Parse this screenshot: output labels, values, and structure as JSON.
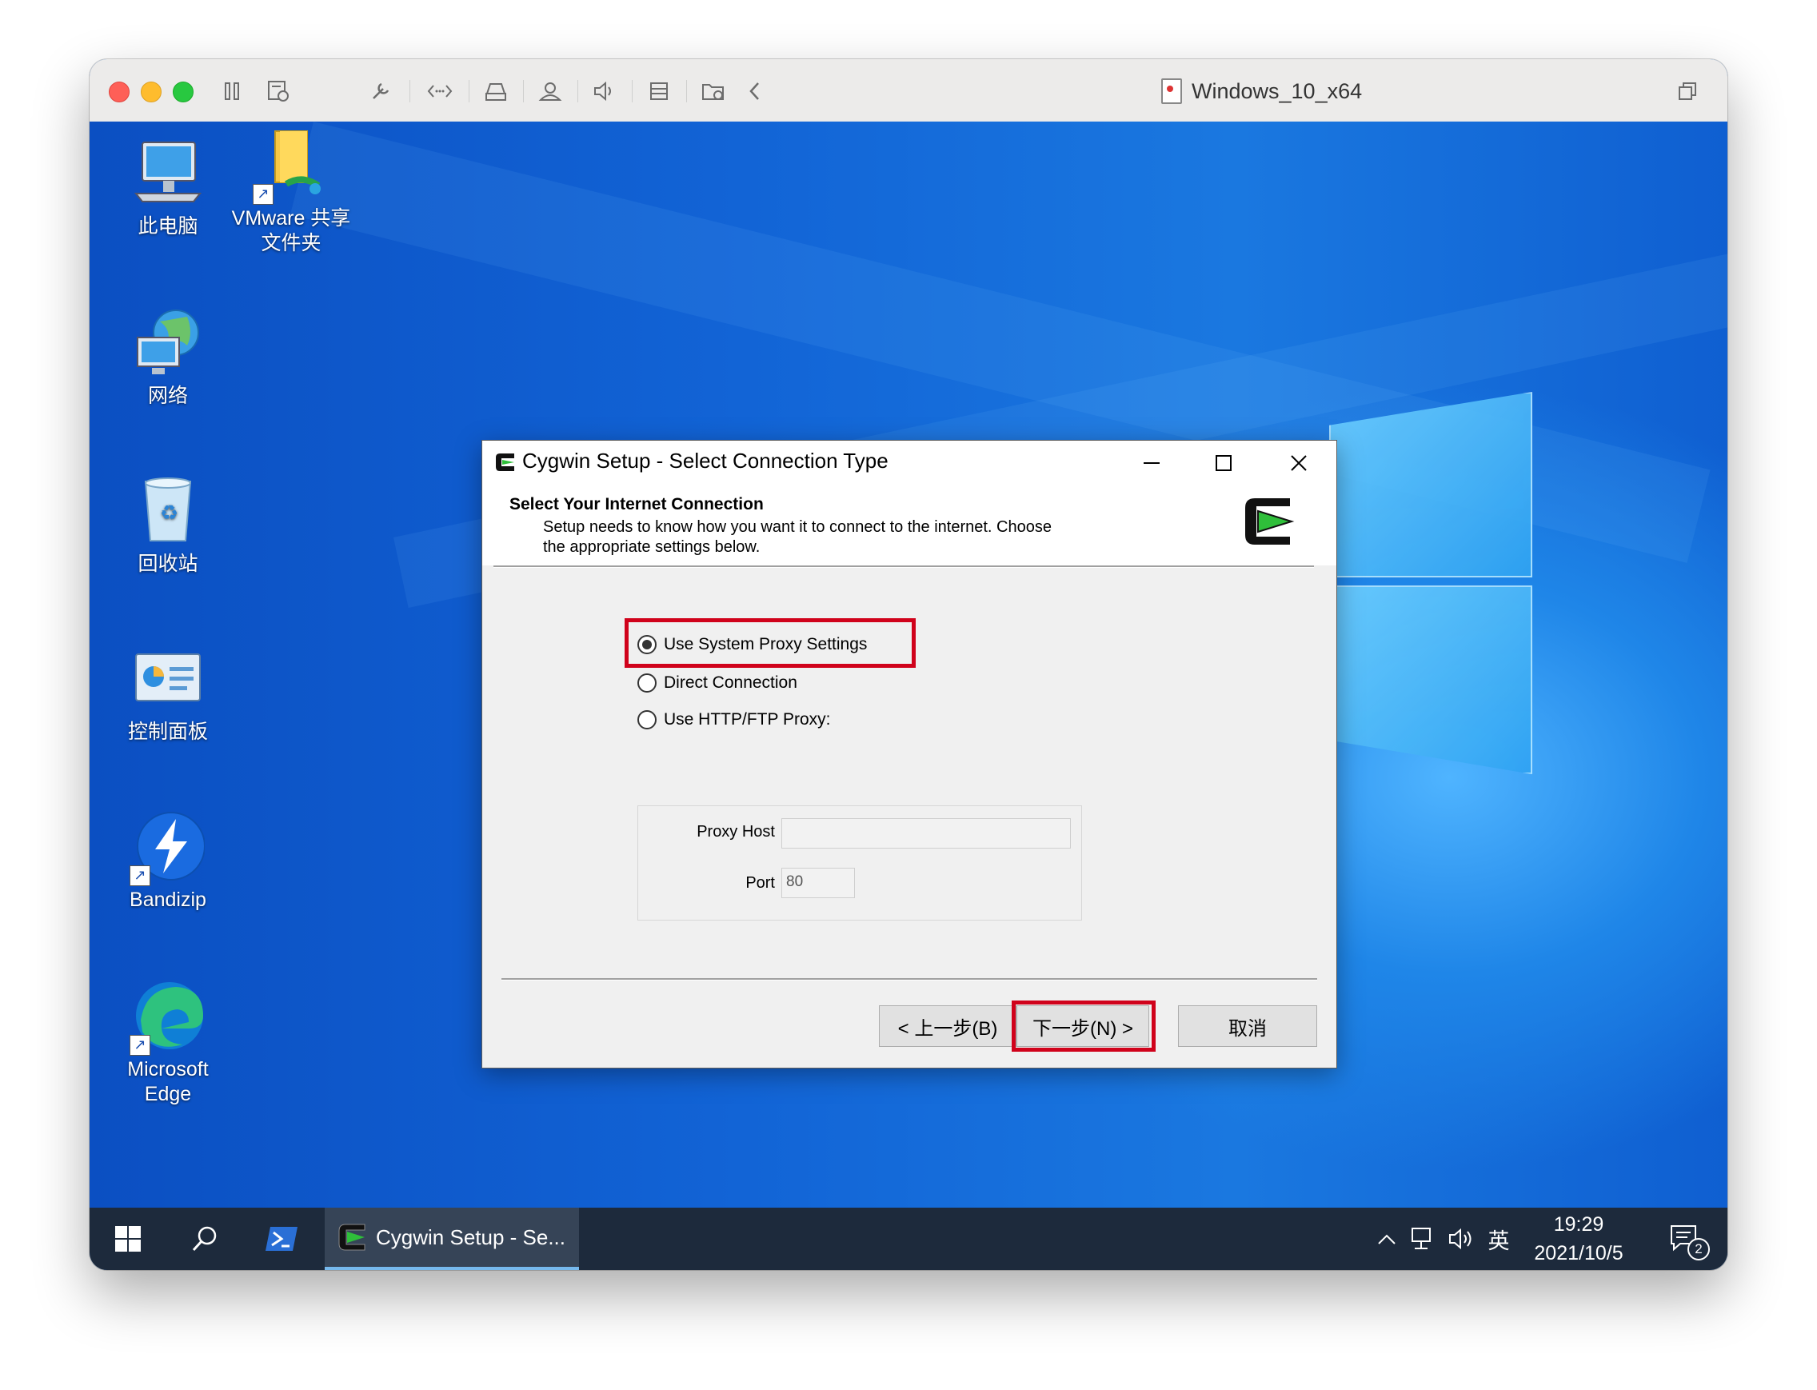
{
  "vm_window": {
    "title": "Windows_10_x64",
    "toolbar_icons": [
      "pause-icon",
      "snapshot-icon",
      "wrench-icon",
      "code-icon",
      "drive-icon",
      "user-icon",
      "speaker-icon",
      "list-icon",
      "folder-icon",
      "back-icon"
    ]
  },
  "desktop": {
    "icons": [
      {
        "label": "此电脑"
      },
      {
        "label": "VMware 共享\n文件夹"
      },
      {
        "label": "网络"
      },
      {
        "label": "回收站"
      },
      {
        "label": "控制面板"
      },
      {
        "label": "Bandizip"
      },
      {
        "label": "Microsoft\nEdge"
      }
    ]
  },
  "dialog": {
    "title": "Cygwin Setup - Select Connection Type",
    "header_title": "Select Your Internet Connection",
    "header_desc_line1": "Setup needs to know how you want it to connect to the internet.  Choose",
    "header_desc_line2": "the appropriate settings below.",
    "options": [
      {
        "label": "Use System Proxy Settings",
        "selected": true
      },
      {
        "label": "Direct Connection",
        "selected": false
      },
      {
        "label": "Use HTTP/FTP Proxy:",
        "selected": false
      }
    ],
    "proxy_host_label": "Proxy Host",
    "proxy_host_value": "",
    "port_label": "Port",
    "port_value": "80",
    "back_button": "< 上一步(B)",
    "next_button": "下一步(N) >",
    "cancel_button": "取消"
  },
  "taskbar": {
    "active_app": "Cygwin Setup - Se...",
    "ime": "英",
    "time": "19:29",
    "date": "2021/10/5",
    "notification_count": "2"
  },
  "colors": {
    "highlight": "#d0021b",
    "desktop": "#1a78e0",
    "taskbar": "#1d2a3c"
  }
}
